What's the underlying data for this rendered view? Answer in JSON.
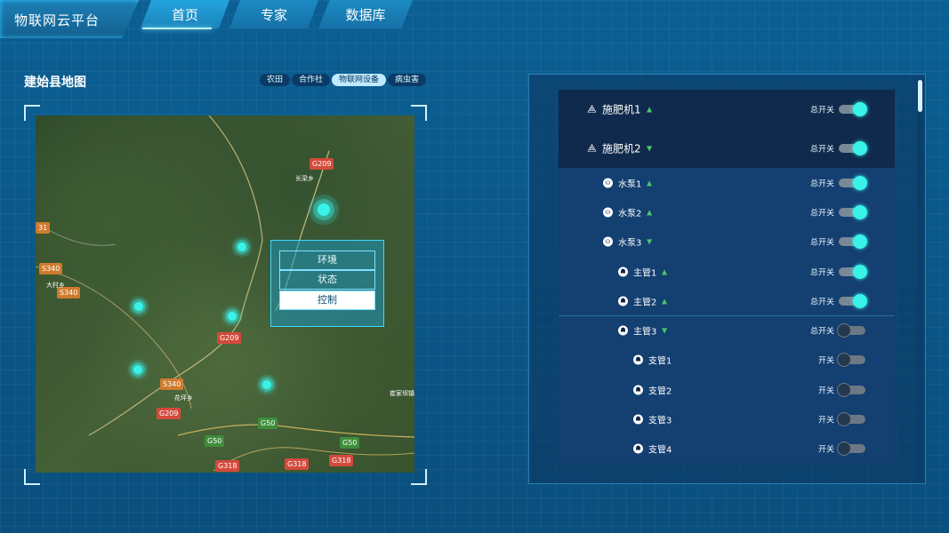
{
  "app": {
    "title": "物联网云平台"
  },
  "nav": {
    "items": [
      {
        "label": "首页",
        "active": true
      },
      {
        "label": "专家",
        "active": false
      },
      {
        "label": "数据库",
        "active": false
      }
    ]
  },
  "map_section": {
    "title": "建始县地图",
    "chips": [
      {
        "label": "农田",
        "selected": false
      },
      {
        "label": "合作社",
        "selected": false
      },
      {
        "label": "物联网设备",
        "selected": true
      },
      {
        "label": "病虫害",
        "selected": false
      }
    ],
    "roads": [
      "G209",
      "G209",
      "G209",
      "S340",
      "S340",
      "S340",
      "G50",
      "G50",
      "G318",
      "G318",
      "G318",
      "31"
    ],
    "places": [
      "长梁乡",
      "大村乡",
      "花坪乡",
      "崔家坝镇"
    ],
    "popup": {
      "options": [
        {
          "label": "环境",
          "active": false
        },
        {
          "label": "状态",
          "active": false
        },
        {
          "label": "控制",
          "active": true
        }
      ]
    },
    "highlight_color": "#39f3e9"
  },
  "device_panel": {
    "rows": [
      {
        "name": "施肥机1",
        "level": 0,
        "icon": "fertilizer-icon",
        "expand": "up",
        "switch_label": "总开关",
        "on": true
      },
      {
        "name": "施肥机2",
        "level": 0,
        "icon": "fertilizer-icon",
        "expand": "down",
        "switch_label": "总开关",
        "on": true
      },
      {
        "name": "水泵1",
        "level": 1,
        "icon": "pump-icon",
        "expand": "up",
        "switch_label": "总开关",
        "on": true
      },
      {
        "name": "水泵2",
        "level": 1,
        "icon": "pump-icon",
        "expand": "up",
        "switch_label": "总开关",
        "on": true
      },
      {
        "name": "水泵3",
        "level": 1,
        "icon": "pump-icon",
        "expand": "down",
        "switch_label": "总开关",
        "on": true
      },
      {
        "name": "主管1",
        "level": 2,
        "icon": "pipe-icon",
        "expand": "up",
        "switch_label": "总开关",
        "on": true
      },
      {
        "name": "主管2",
        "level": 2,
        "icon": "pipe-icon",
        "expand": "up",
        "switch_label": "总开关",
        "on": true
      },
      {
        "name": "主管3",
        "level": 2,
        "icon": "pipe-icon",
        "expand": "down",
        "switch_label": "总开关",
        "on": false
      },
      {
        "name": "支管1",
        "level": 3,
        "icon": "pipe-icon",
        "expand": "",
        "switch_label": "开关",
        "on": false
      },
      {
        "name": "支管2",
        "level": 3,
        "icon": "pipe-icon",
        "expand": "",
        "switch_label": "开关",
        "on": false
      },
      {
        "name": "支管3",
        "level": 3,
        "icon": "pipe-icon",
        "expand": "",
        "switch_label": "开关",
        "on": false
      },
      {
        "name": "支管4",
        "level": 3,
        "icon": "pipe-icon",
        "expand": "",
        "switch_label": "开关",
        "on": false
      }
    ]
  }
}
